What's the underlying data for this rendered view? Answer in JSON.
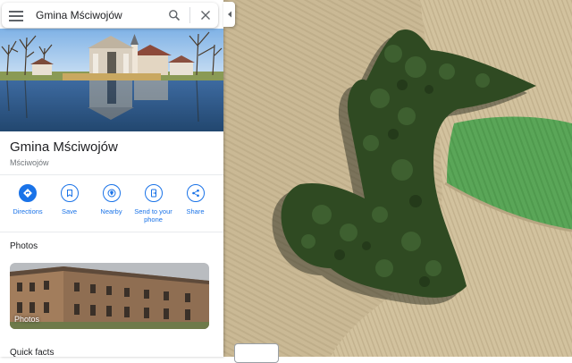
{
  "search": {
    "value": "Gmina Mściwojów"
  },
  "place": {
    "title": "Gmina Mściwojów",
    "subtitle": "Mściwojów"
  },
  "actions": [
    {
      "label": "Directions",
      "icon": "directions-icon"
    },
    {
      "label": "Save",
      "icon": "bookmark-icon"
    },
    {
      "label": "Nearby",
      "icon": "nearby-icon"
    },
    {
      "label": "Send to your\nphone",
      "icon": "send-to-phone-icon"
    },
    {
      "label": "Share",
      "icon": "share-icon"
    }
  ],
  "sections": {
    "photos": "Photos",
    "photo_label": "Photos",
    "quick_facts": "Quick facts"
  },
  "colors": {
    "accent": "#1a73e8",
    "field_green": "#5aa658",
    "field_tan": "#c9b892",
    "forest": "#2f4a22"
  }
}
